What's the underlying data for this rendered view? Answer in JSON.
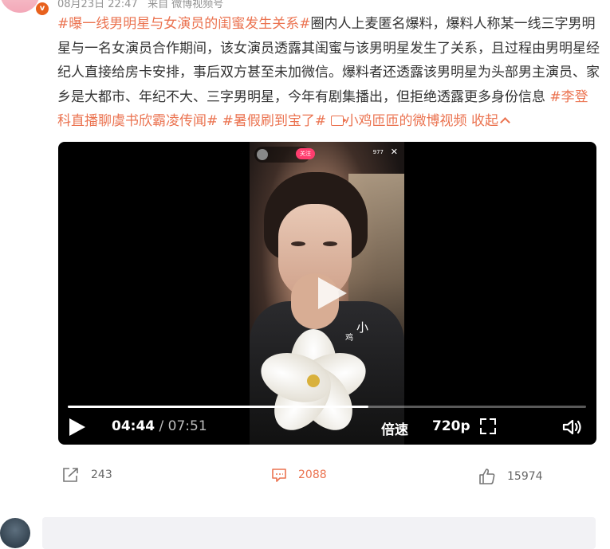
{
  "post": {
    "meta_date": "08月23日 22:47",
    "meta_source": "来自 微博视频号",
    "topic_title": "#曝一线男明星与女演员的闺蜜发生关系#",
    "body": "圈内人上麦匿名爆料，爆料人称某一线三字男明星与一名女演员合作期间，该女演员透露其闺蜜与该男明星发生了关系，且过程由男明星经纪人直接给房卡安排，事后双方甚至未加微信。爆料者还透露该男明星为头部男主演员、家乡是大都市、年纪不大、三字男明星，今年有剧集播出，但拒绝透露更多身份信息",
    "topic_2": "#李登科直播聊虞书欣霸凌传闻#",
    "topic_3": "#暑假刷到宝了#",
    "video_link": "小鸡匝匝的微博视频",
    "collapse": "收起"
  },
  "video": {
    "current_time": "04:44",
    "separator": " / ",
    "duration": "07:51",
    "progress_fraction": 0.58,
    "speed_label": "倍速",
    "quality_label": "720p",
    "overlay_small_1": "小",
    "overlay_small_2": "鸡",
    "live_follow": "关注",
    "live_viewers": "977"
  },
  "actions": {
    "share_count": "243",
    "comment_count": "2088",
    "like_count": "15974"
  },
  "colors": {
    "accent": "#eb7350"
  }
}
